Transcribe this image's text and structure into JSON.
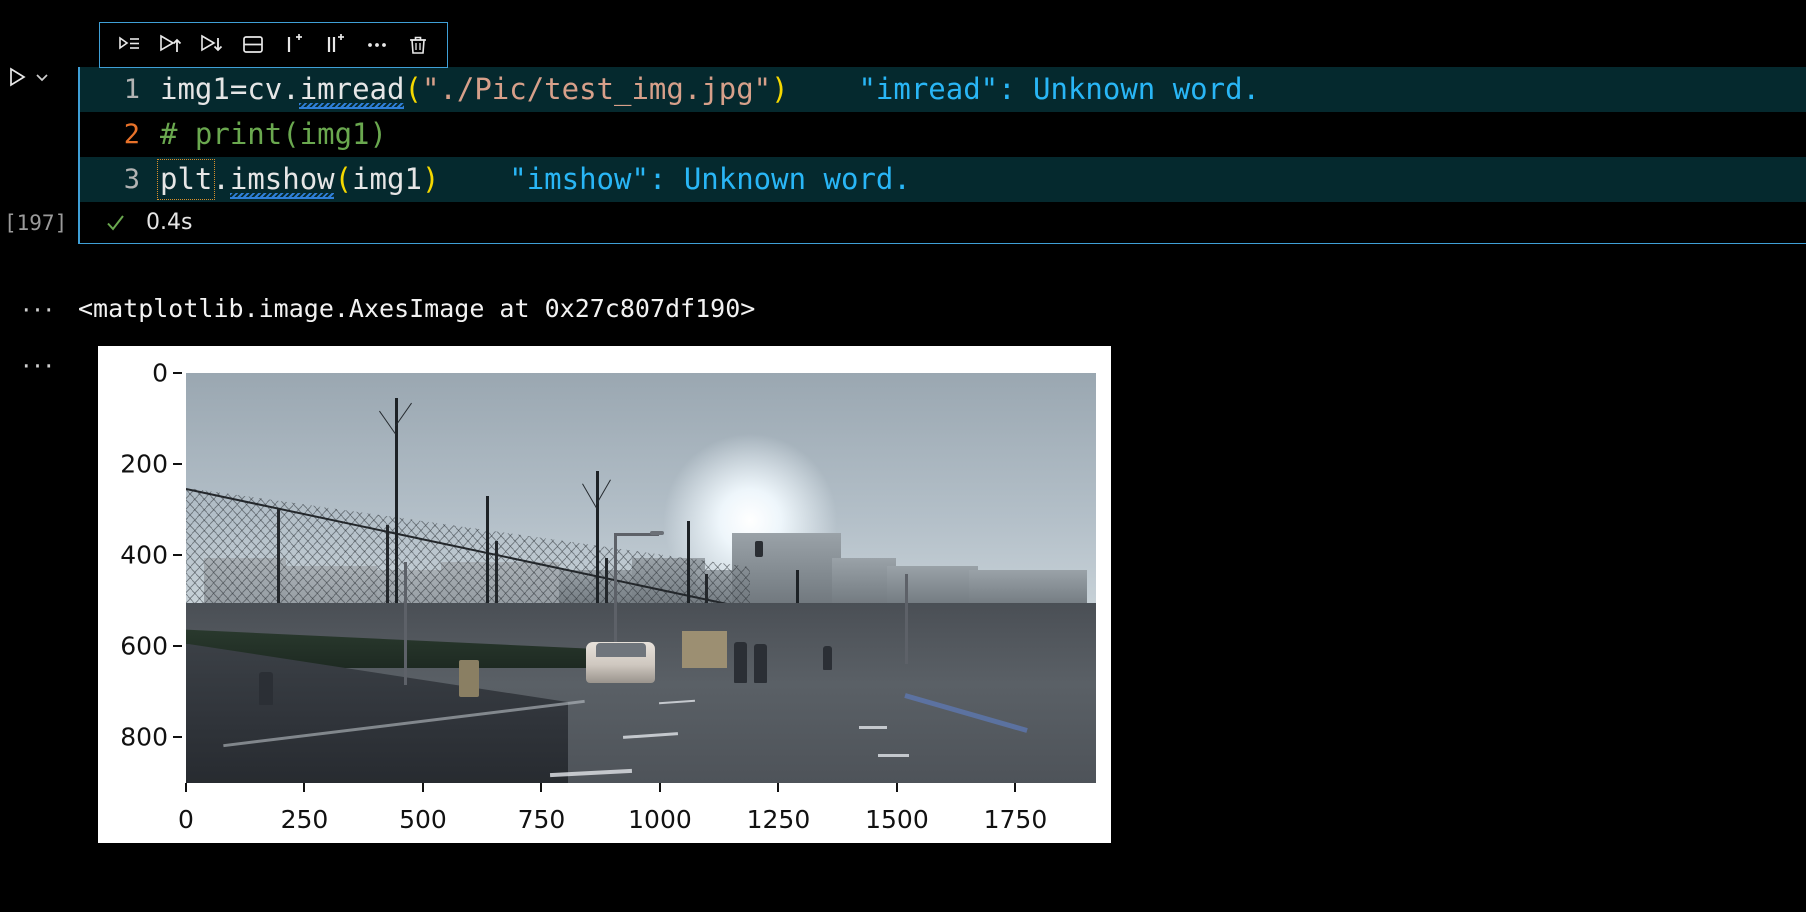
{
  "toolbar": {
    "buttons": [
      {
        "name": "execute-above-cells",
        "icon": "run-above-icon",
        "title": "Execute Above Cells"
      },
      {
        "name": "execute-cell-and-above",
        "icon": "run-up-icon",
        "title": "Execute Cell and Above"
      },
      {
        "name": "execute-cell-and-below",
        "icon": "run-down-icon",
        "title": "Execute Cell and Below"
      },
      {
        "name": "split-cell",
        "icon": "split-cell-icon",
        "title": "Split Cell"
      },
      {
        "name": "insert-code-cell",
        "icon": "add-cell-icon",
        "title": "Insert Cell"
      },
      {
        "name": "insert-markdown-cell",
        "icon": "add-markdown-cell-icon",
        "title": "Insert Markdown Cell"
      },
      {
        "name": "more-actions",
        "icon": "ellipsis-icon",
        "title": "More Actions..."
      },
      {
        "name": "delete-cell",
        "icon": "trash-icon",
        "title": "Delete Cell"
      }
    ]
  },
  "gutter": {
    "run_button": "run-cell-icon",
    "run_options": "chevron-down-icon"
  },
  "cell": {
    "execution_count": "[197]",
    "status_icon": "check-icon",
    "run_time": "0.4s",
    "lines": [
      {
        "number": "1",
        "active": false,
        "highlighted": true,
        "tokens": [
          {
            "text": "img1",
            "cls": "t-plain"
          },
          {
            "text": "=",
            "cls": "t-op"
          },
          {
            "text": "cv",
            "cls": "t-plain"
          },
          {
            "text": ".",
            "cls": "t-op"
          },
          {
            "text": "imread",
            "cls": "t-func"
          },
          {
            "text": "(",
            "cls": "t-paren"
          },
          {
            "text": "\"./Pic/test_img.jpg\"",
            "cls": "t-str"
          },
          {
            "text": ")",
            "cls": "t-paren"
          }
        ],
        "annotation": "\"imread\": Unknown word.",
        "squiggle_word": "imread"
      },
      {
        "number": "2",
        "active": true,
        "highlighted": false,
        "tokens": [
          {
            "text": "# print(img1)",
            "cls": "t-comment"
          }
        ],
        "annotation": "",
        "squiggle_word": ""
      },
      {
        "number": "3",
        "active": false,
        "highlighted": true,
        "tokens": [
          {
            "text": "plt",
            "cls": "t-plain"
          },
          {
            "text": ".",
            "cls": "t-op"
          },
          {
            "text": "imshow",
            "cls": "t-func"
          },
          {
            "text": "(",
            "cls": "t-paren"
          },
          {
            "text": "img1",
            "cls": "t-plain"
          },
          {
            "text": ")",
            "cls": "t-paren"
          }
        ],
        "annotation": "\"imshow\": Unknown word.",
        "squiggle_word": "imshow",
        "word_box": "plt"
      }
    ]
  },
  "outputs": [
    {
      "name": "text-output",
      "dots": "···",
      "text": "<matplotlib.image.AxesImage at 0x27c807df190>"
    },
    {
      "name": "plot-output",
      "dots": "···",
      "text": ""
    }
  ],
  "chart_data": {
    "type": "heatmap",
    "title": "",
    "xlabel": "",
    "ylabel": "",
    "description": "matplotlib imshow of a 1920x900 street-scene photograph (BGR channel order from cv.imread)",
    "xticks": [
      0,
      250,
      500,
      750,
      1000,
      1250,
      1500,
      1750
    ],
    "yticks": [
      0,
      200,
      400,
      600,
      800
    ],
    "xlim": [
      0,
      1920
    ],
    "ylim": [
      900,
      0
    ],
    "grid": false,
    "legend": null
  },
  "colors": {
    "accent": "#3f9fd6",
    "annotation": "#29b6f6",
    "comment": "#6aa84f",
    "string": "#d7a08a",
    "paren": "#f5d800",
    "active_line_number": "#e8722a",
    "success": "#6aa84f",
    "cell_background": "#000000",
    "highlight_background": "#05292e",
    "squiggle": "#2f7fd8",
    "word_box": "#d98f2a"
  }
}
